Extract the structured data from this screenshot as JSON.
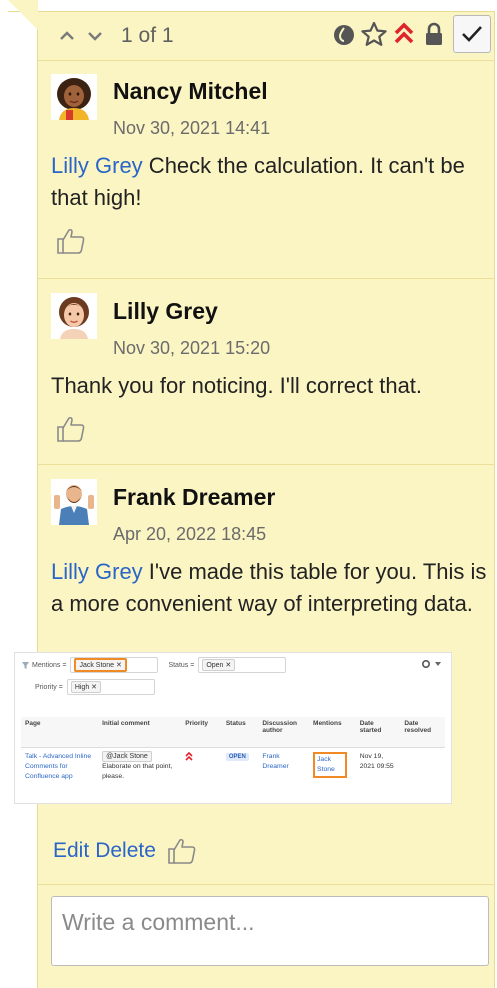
{
  "header": {
    "counter": "1 of 1",
    "icons": [
      "chevron-up-icon",
      "chevron-down-icon",
      "drop-icon",
      "star-icon",
      "priority-icon",
      "lock-icon",
      "check-icon"
    ]
  },
  "comments": [
    {
      "author": "Nancy Mitchel",
      "time": "Nov 30, 2021 14:41",
      "mention": "Lilly Grey",
      "text": " Check the calculation. It can't be that high!"
    },
    {
      "author": "Lilly Grey",
      "time": "Nov 30, 2021 15:20",
      "text": "Thank you for noticing. I'll correct that."
    },
    {
      "author": "Frank Dreamer",
      "time": "Apr 20, 2022 18:45",
      "mention": "Lilly Grey",
      "text": " I've made this table for you. This is a more convenient way of interpreting data."
    }
  ],
  "embed": {
    "filters": {
      "mentions_label": "Mentions =",
      "mentions_value": "Jack Stone ✕",
      "status_label": "Status =",
      "status_value": "Open ✕",
      "priority_label": "Priority =",
      "priority_value": "High ✕"
    },
    "columns": [
      "Page",
      "Initial comment",
      "Priority",
      "Status",
      "Discussion author",
      "Mentions",
      "Date started",
      "Date resolved"
    ],
    "row": {
      "page": "Talk - Advanced Inline Comments for Confluence app",
      "comment_mention": "@Jack Stone",
      "comment_text": "Elaborate on that point, please.",
      "status": "OPEN",
      "author": "Frank Dreamer",
      "mentions": "Jack Stone",
      "date_started": "Nov 19, 2021 09:55",
      "date_resolved": ""
    }
  },
  "actions": {
    "edit": "Edit",
    "delete": "Delete"
  },
  "composer": {
    "placeholder": "Write a comment..."
  },
  "colors": {
    "panel": "#fbf5c4",
    "mention": "#2a66c8",
    "priority": "#e0242b"
  }
}
